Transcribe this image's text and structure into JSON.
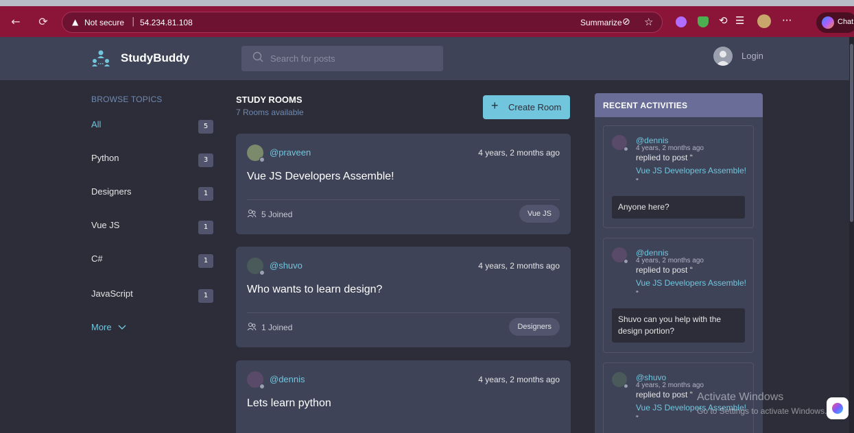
{
  "browser": {
    "back_glyph": "←",
    "reload_glyph": "⟳",
    "security_text": "Not secure",
    "separator": "|",
    "url": "54.234.81.108",
    "summarize_label": "Summarize",
    "more_glyph": "···",
    "chat_label": "Chat",
    "colors": {
      "bar": "#8a1538",
      "address": "#6d1230"
    }
  },
  "header": {
    "brand": "StudyBuddy",
    "search_placeholder": "Search for posts",
    "login_label": "Login"
  },
  "sidebar": {
    "title": "BROWSE TOPICS",
    "topics": [
      {
        "name": "All",
        "count": "5",
        "active": true
      },
      {
        "name": "Python",
        "count": "3"
      },
      {
        "name": "Designers",
        "count": "1"
      },
      {
        "name": "Vue JS",
        "count": "1"
      },
      {
        "name": "C#",
        "count": "1"
      },
      {
        "name": "JavaScript",
        "count": "1"
      }
    ],
    "more_label": "More"
  },
  "rooms": {
    "title": "STUDY ROOMS",
    "subtitle": "7 Rooms available",
    "create_label": "Create Room",
    "items": [
      {
        "user": "@praveen",
        "time": "4 years, 2 months ago",
        "title": "Vue JS Developers Assemble!",
        "joined": "5 Joined",
        "tag": "Vue JS"
      },
      {
        "user": "@shuvo",
        "time": "4 years, 2 months ago",
        "title": "Who wants to learn design?",
        "joined": "1 Joined",
        "tag": "Designers"
      },
      {
        "user": "@dennis",
        "time": "4 years, 2 months ago",
        "title": "Lets learn python",
        "joined": "",
        "tag": ""
      }
    ]
  },
  "activities": {
    "title": "RECENT ACTIVITIES",
    "items": [
      {
        "user": "@dennis",
        "time": "4 years, 2 months ago",
        "replied": "replied to post “",
        "post": "Vue JS Developers Assemble!",
        "quote": "”",
        "message": "Anyone here?"
      },
      {
        "user": "@dennis",
        "time": "4 years, 2 months ago",
        "replied": "replied to post “",
        "post": "Vue JS Developers Assemble!",
        "quote": "”",
        "message": "Shuvo can you help with the design portion?"
      },
      {
        "user": "@shuvo",
        "time": "4 years, 2 months ago",
        "replied": "replied to post “",
        "post": "Vue JS Developers Assemble!",
        "quote": "”",
        "message": ""
      }
    ]
  },
  "watermark": {
    "line1": "Activate Windows",
    "line2": "Go to Settings to activate Windows."
  },
  "theme": {
    "accent": "#71c6dd",
    "card": "#3e4358",
    "background": "#2d2d39",
    "activity_header": "#696d97"
  }
}
